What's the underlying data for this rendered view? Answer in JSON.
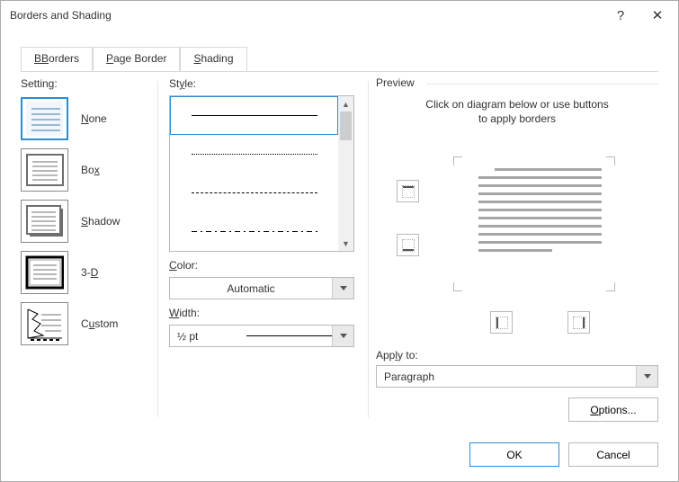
{
  "window": {
    "title": "Borders and Shading"
  },
  "tabs": {
    "borders": "Borders",
    "page_border": "Page Border",
    "shading": "Shading"
  },
  "setting": {
    "label": "Setting:",
    "none": {
      "char": "N",
      "rest": "one"
    },
    "box": {
      "char": "x",
      "pre": "Bo"
    },
    "shadow": {
      "char": "S",
      "rest": "hadow"
    },
    "threed": {
      "char": "D",
      "pre": "3-"
    },
    "custom": {
      "char": "u",
      "pre": "C",
      "rest": "stom"
    }
  },
  "middle": {
    "style_label": "Style:",
    "color_label": "Color:",
    "color_value": "Automatic",
    "width_label": "Width:",
    "width_value": "½ pt"
  },
  "preview": {
    "title": "Preview",
    "caption_l1": "Click on diagram below or use buttons",
    "caption_l2": "to apply borders",
    "apply_label": "Apply to:",
    "apply_value": "Paragraph",
    "options_char": "O",
    "options_rest": "ptions..."
  },
  "buttons": {
    "ok": "OK",
    "cancel": "Cancel"
  }
}
